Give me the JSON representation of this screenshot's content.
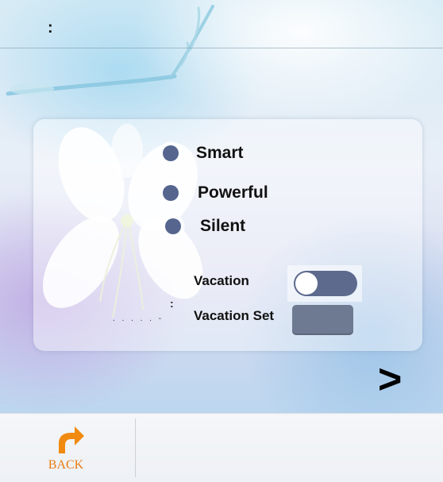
{
  "header": {
    "title": ":"
  },
  "modes": [
    {
      "label": "Smart"
    },
    {
      "label": "Powerful"
    },
    {
      "label": "Silent"
    }
  ],
  "vacation": {
    "label": "Vacation",
    "toggle_on": false
  },
  "vacation_set": {
    "label": "Vacation Set"
  },
  "decor_text": {
    "dots": ". . . . . -",
    "colon": ":"
  },
  "nav": {
    "next": ">"
  },
  "footer": {
    "back_label": "BACK"
  },
  "colors": {
    "radio": "#55658e",
    "toggle_track": "#5d6a8e",
    "vacation_set_button": "#6e7a92",
    "back_icon": "#f08a10"
  },
  "icons": {
    "back": "back-arrow-icon",
    "next": "chevron-right-icon",
    "flower": "flower-icon",
    "branch": "branch-icon"
  }
}
